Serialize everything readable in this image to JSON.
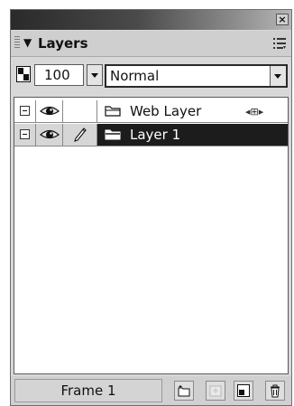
{
  "panel": {
    "title": "Layers",
    "close_glyph": "×",
    "icons": [
      "close-icon",
      "grip-icon",
      "collapse-triangle-icon",
      "panel-options-icon"
    ]
  },
  "controls": {
    "opacity_value": "100",
    "blend_mode": "Normal",
    "icons": [
      "opacity-icon",
      "dropdown-arrow-icon"
    ]
  },
  "layers": [
    {
      "name": "Web Layer",
      "type": "web-layer",
      "visible": true,
      "editable": false,
      "selected": false,
      "icons": [
        "collapse-icon",
        "eye-icon",
        "folder-icon",
        "share-layer-icon"
      ]
    },
    {
      "name": "Layer 1",
      "type": "layer",
      "visible": true,
      "editable": true,
      "selected": true,
      "icons": [
        "collapse-icon",
        "eye-icon",
        "pencil-icon",
        "folder-icon"
      ]
    }
  ],
  "bottom": {
    "frame_label": "Frame 1",
    "tools": [
      "new-layer-icon",
      "new-sub-layer-icon",
      "duplicate-layer-icon",
      "delete-layer-icon"
    ]
  },
  "colors": {
    "selected_row": "#1c1c1c",
    "panel_background": "#d8d8d8"
  }
}
